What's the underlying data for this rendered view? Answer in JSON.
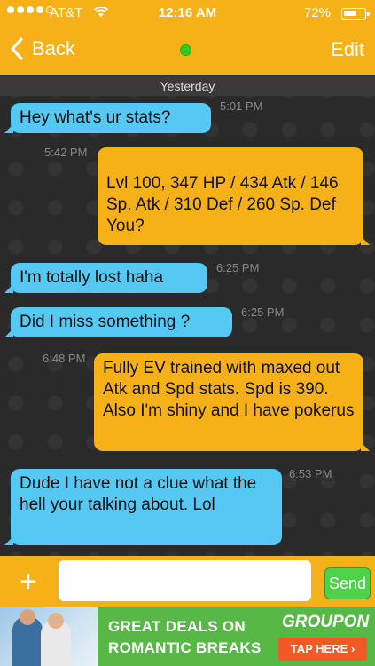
{
  "status_bar": {
    "carrier": "AT&T",
    "time": "12:16 AM",
    "battery_percent": "72%",
    "battery_level": 0.72,
    "signal_bars_filled": 4,
    "signal_bars_total": 5
  },
  "nav": {
    "back_label": "Back",
    "edit_label": "Edit",
    "online_color": "#34c924"
  },
  "chat": {
    "day_separator": "Yesterday",
    "messages": [
      {
        "side": "incoming",
        "text": "Hey what's ur stats?",
        "time": "5:01 PM"
      },
      {
        "side": "outgoing",
        "text": "Lvl 100, 347 HP / 434 Atk / 146 Sp. Atk / 310 Def / 260 Sp. Def\nYou?",
        "time": "5:42 PM"
      },
      {
        "side": "incoming",
        "text": "I'm totally lost haha",
        "time": "6:25 PM"
      },
      {
        "side": "incoming",
        "text": "Did I miss something ?",
        "time": "6:25 PM"
      },
      {
        "side": "outgoing",
        "text": "Fully EV trained with maxed out Atk and Spd stats. Spd is 390. Also I'm shiny and I have pokerus",
        "time": "6:48 PM"
      },
      {
        "side": "incoming",
        "text": "Dude I have not a clue what the hell your talking about. Lol",
        "time": "6:53 PM"
      }
    ]
  },
  "composer": {
    "plus_icon": "plus-icon",
    "input_value": "",
    "send_label": "Send"
  },
  "ad": {
    "headline_line1": "GREAT DEALS ON",
    "headline_line2": "ROMANTIC BREAKS",
    "brand": "GROUPON",
    "cta": "TAP HERE ›"
  },
  "colors": {
    "brand_yellow": "#f6b119",
    "incoming_bubble": "#56c8f4",
    "outgoing_bubble": "#f6b119",
    "send_green": "#4dd24a",
    "ad_green": "#57b846",
    "ad_cta": "#f15a24"
  }
}
